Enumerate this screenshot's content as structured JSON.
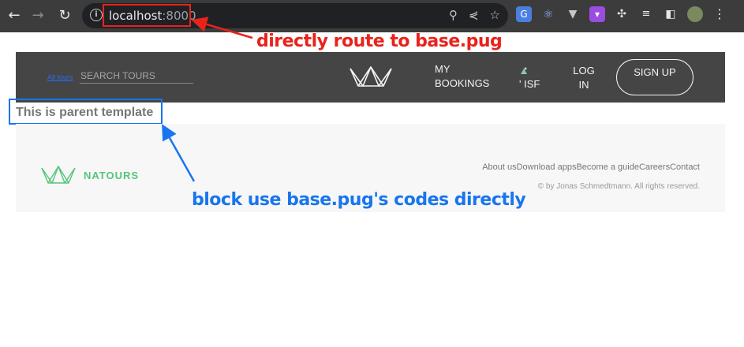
{
  "browser": {
    "url_host": "localhost",
    "url_port": ":8000",
    "extension_icons": [
      "translate-icon",
      "react-icon",
      "vue-icon",
      "tab-icon",
      "puzzle-icon",
      "media-icon",
      "sidebar-icon",
      "profile-avatar"
    ]
  },
  "header": {
    "all_tours": "All tours",
    "search_placeholder": "SEARCH TOURS",
    "my_bookings": "MY BOOKINGS",
    "user_name": "' ISF",
    "login": "LOG IN",
    "signup": "SIGN UP"
  },
  "main": {
    "parent_text": "This is parent template"
  },
  "footer": {
    "brand": "NATOURS",
    "links": [
      "About us",
      "Download apps",
      "Become a guide",
      "Careers",
      "Contact"
    ],
    "copyright": "© by Jonas Schmedtmann. All rights reserved."
  },
  "annotations": {
    "red_text": "directly route to base.pug",
    "blue_text": "block use base.pug's codes directly",
    "red_color": "#e8231b",
    "blue_color": "#1875ef"
  },
  "colors": {
    "header_bg": "#454545",
    "footer_bg": "#f7f7f7",
    "brand_green": "#55c57a"
  }
}
